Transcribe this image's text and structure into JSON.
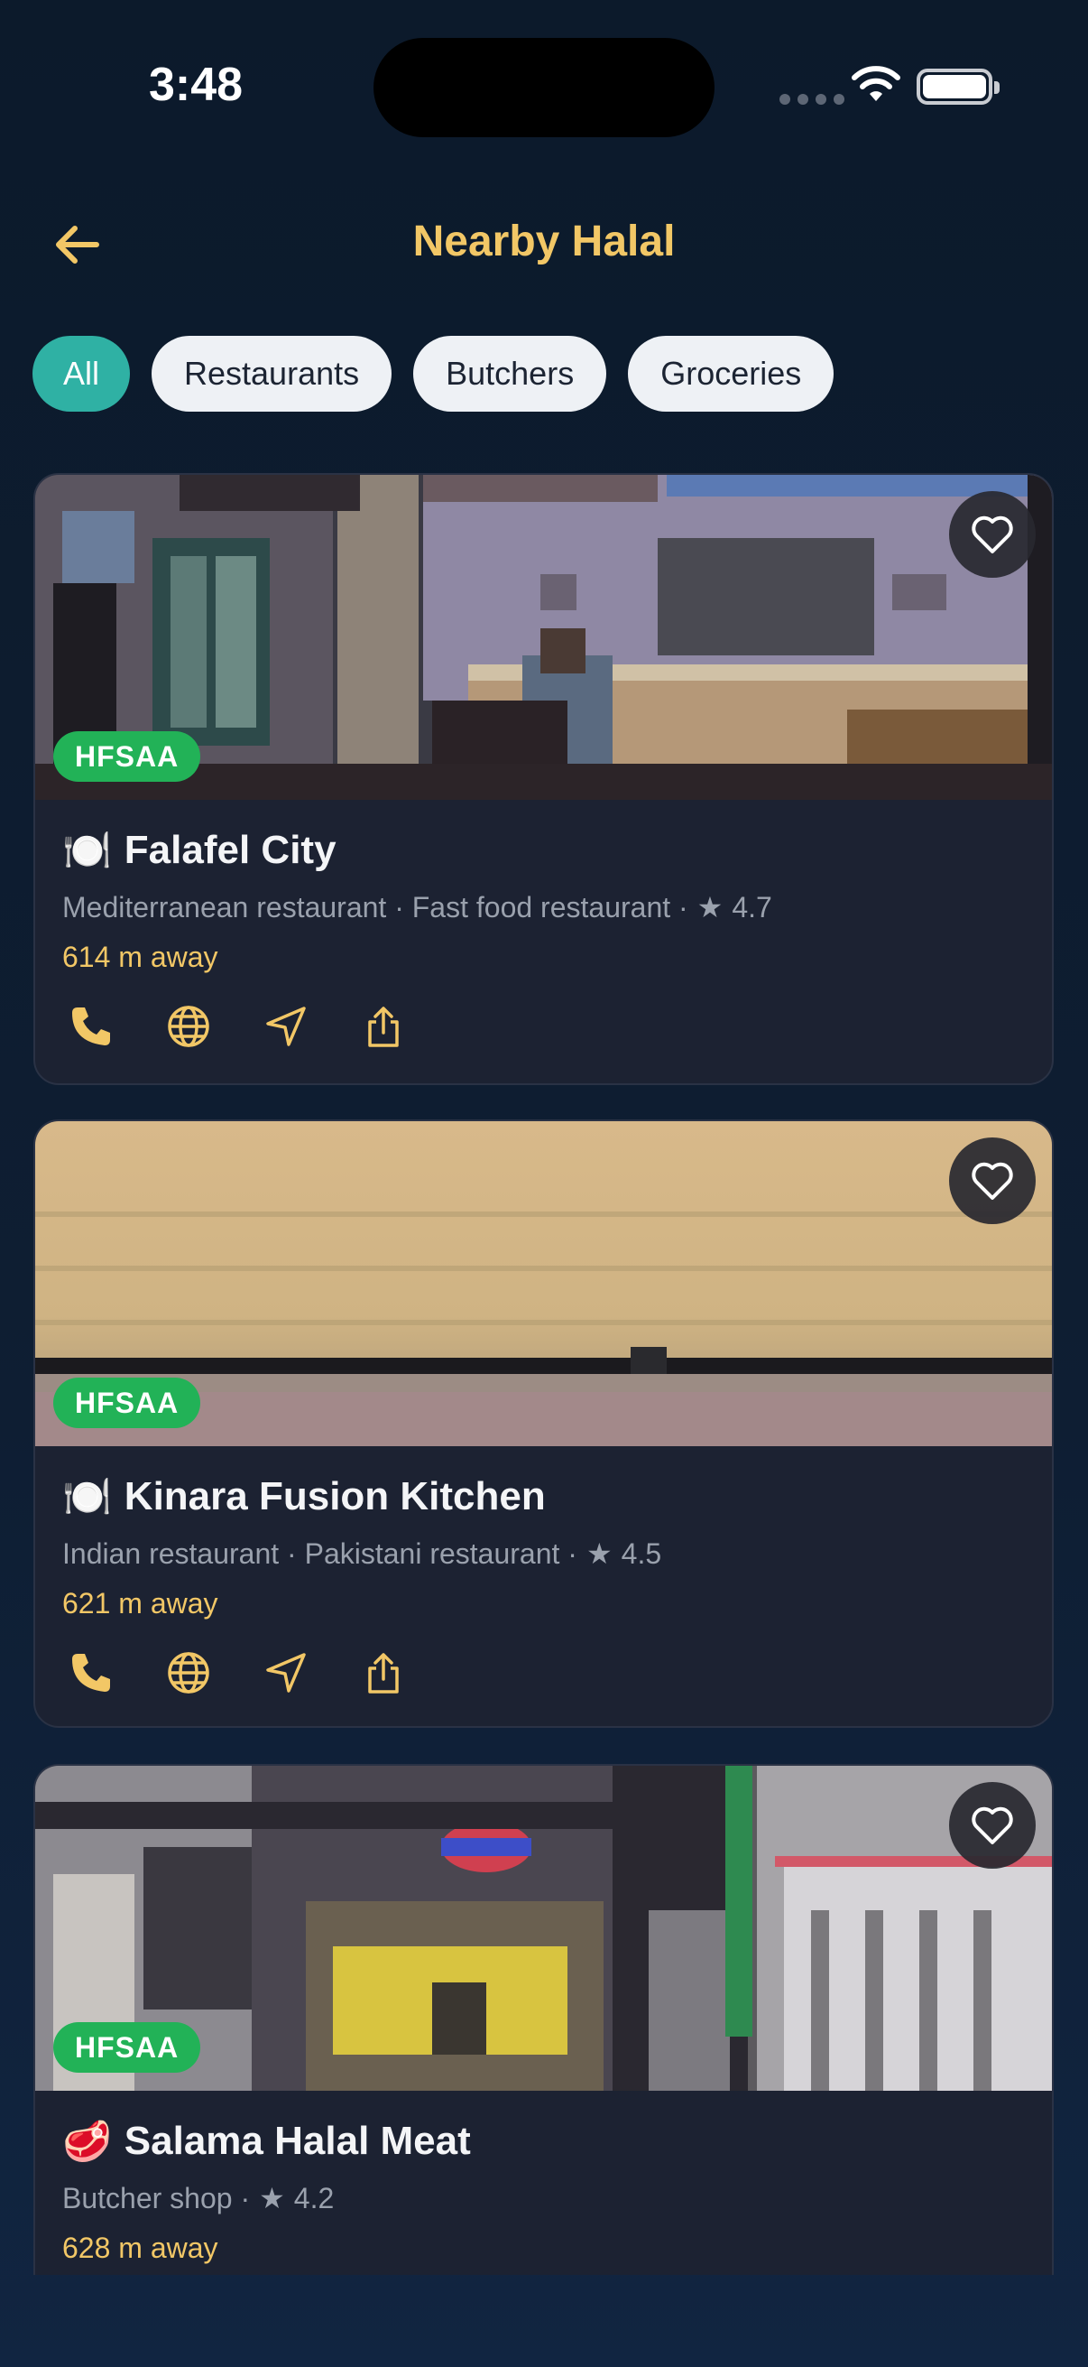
{
  "status_bar": {
    "time": "3:48"
  },
  "header": {
    "title": "Nearby Halal"
  },
  "filters": [
    {
      "label": "All",
      "active": true
    },
    {
      "label": "Restaurants",
      "active": false
    },
    {
      "label": "Butchers",
      "active": false
    },
    {
      "label": "Groceries",
      "active": false
    }
  ],
  "places": [
    {
      "emoji": "🍽️",
      "name": "Falafel City",
      "badge": "HFSAA",
      "categories": "Mediterranean restaurant · Fast food restaurant ·",
      "rating": "4.7",
      "distance": "614 m away"
    },
    {
      "emoji": "🍽️",
      "name": "Kinara Fusion Kitchen",
      "badge": "HFSAA",
      "categories": "Indian restaurant · Pakistani restaurant ·",
      "rating": "4.5",
      "distance": "621 m away"
    },
    {
      "emoji": "🥩",
      "name": "Salama Halal Meat",
      "badge": "HFSAA",
      "categories": "Butcher shop ·",
      "rating": "4.2",
      "distance": "628 m away"
    }
  ],
  "colors": {
    "accent": "#f2c766",
    "chip_active": "#2fb1a4",
    "badge": "#22b257"
  }
}
